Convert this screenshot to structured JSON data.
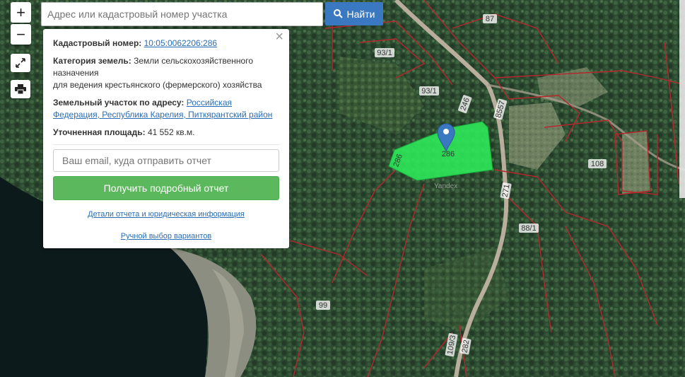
{
  "search": {
    "placeholder": "Адрес или кадастровый номер участка",
    "button_label": "Найти"
  },
  "controls": {
    "zoom_in": "+",
    "zoom_out": "−"
  },
  "popup": {
    "cadastral_label": "Кадастровый номер:",
    "cadastral_value": "10:05:0062206:286",
    "category_label": "Категория земель:",
    "category_value_1": "Земли сельскохозяйственного назначения",
    "category_value_2": "для ведения крестьянского (фермерского) хозяйства",
    "address_label": "Земельный участок по адресу:",
    "address_value_1": "Российская",
    "address_value_2": "Федерация, Республика Карелия, Питкярантский район",
    "area_label": "Уточненная площадь:",
    "area_value": "41 552 кв.м.",
    "email_placeholder": "Ваш email, куда отправить отчет",
    "report_button": "Получить подробный отчет",
    "details_link": "Детали отчета и юридическая информация",
    "manual_link": "Ручной выбор вариантов",
    "close": "×"
  },
  "parcel_labels": [
    "87",
    "93/1",
    "93/1",
    "246",
    "8557",
    "108",
    "271",
    "88/1",
    "99",
    "109/3",
    "282",
    "286",
    "286"
  ],
  "watermark": "Yandex",
  "colors": {
    "parcel_highlight": "#2ee85a",
    "boundary": "#b8262e",
    "button": "#3a78c2",
    "report": "#5cb85c"
  }
}
